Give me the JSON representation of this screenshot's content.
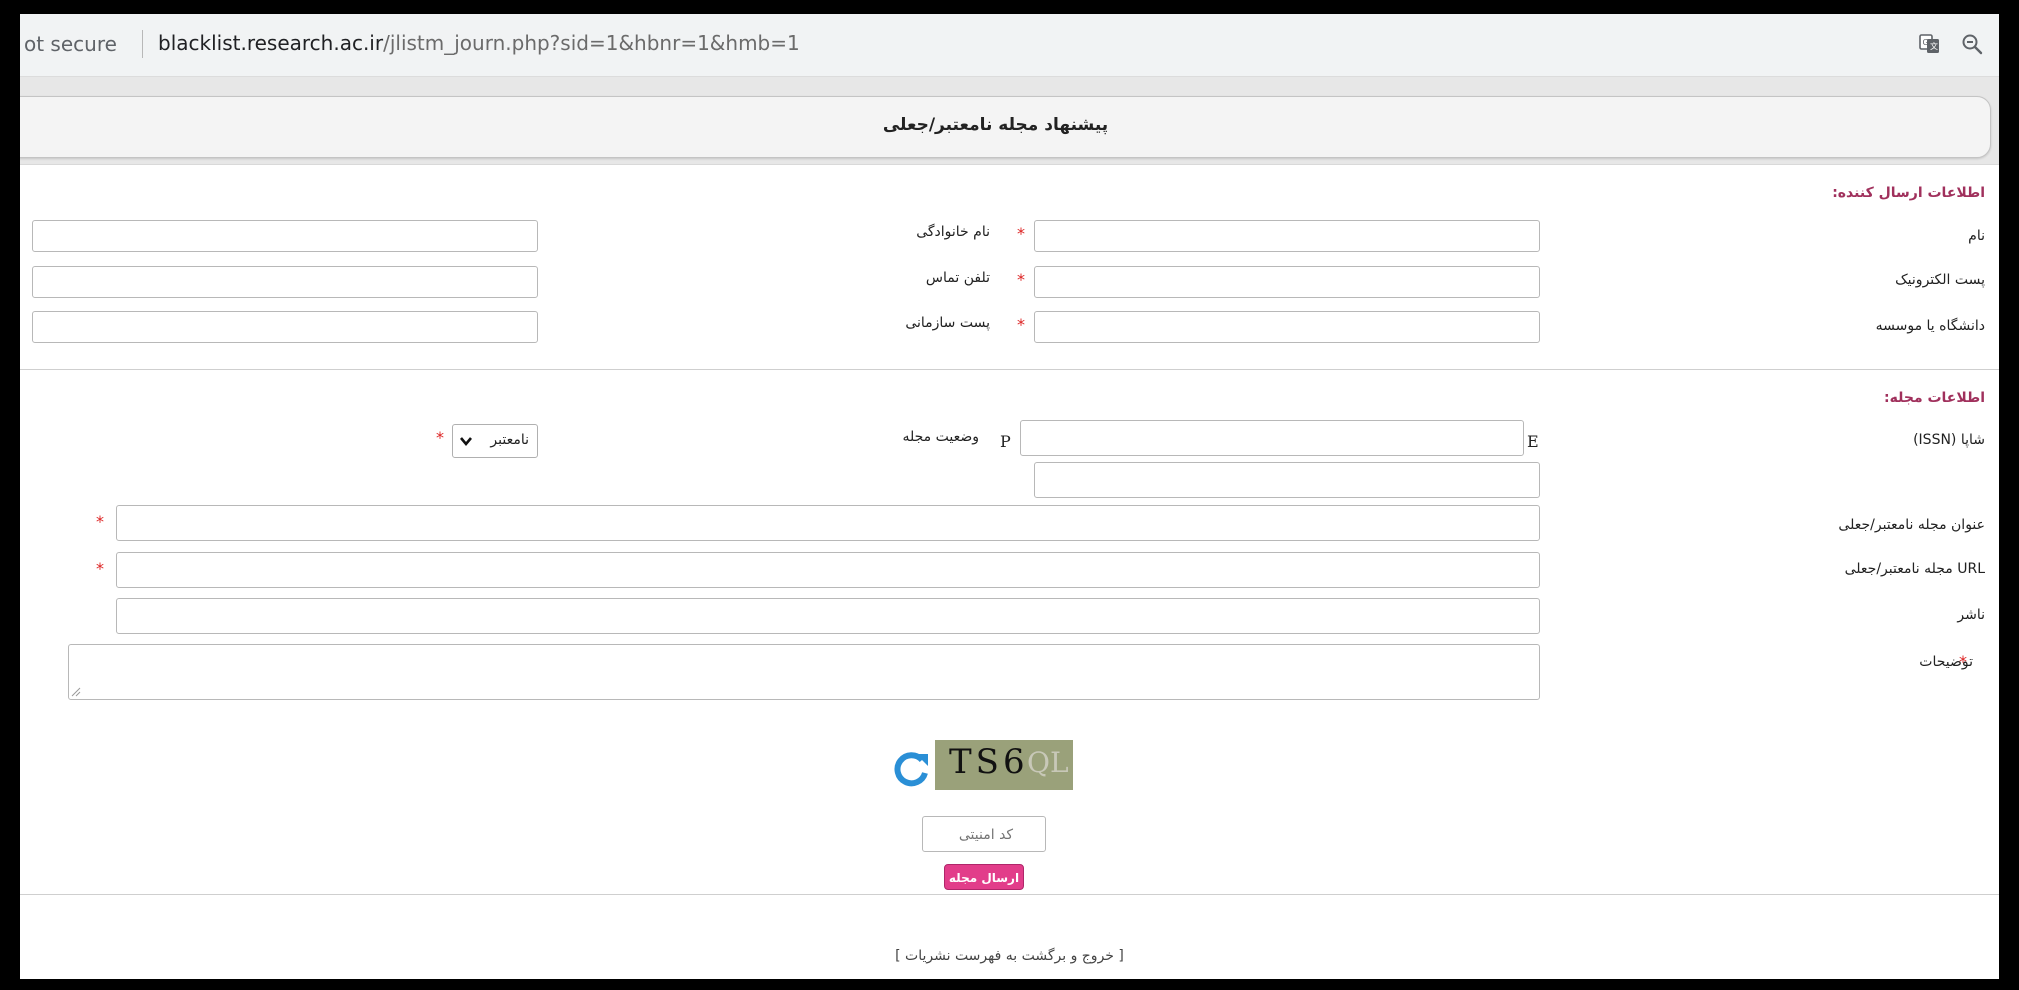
{
  "browser": {
    "security_text": "ot secure",
    "url_domain": "blacklist.research.ac.ir",
    "url_path": "/jlistm_journ.php?sid=1&hbnr=1&hmb=1",
    "icons": [
      "translate-icon",
      "zoom-icon"
    ]
  },
  "page": {
    "title": "پیشنهاد مجله نامعتبر/جعلی"
  },
  "sender": {
    "section_label": "اطلاعات ارسال کننده:",
    "first_name_label": "نام",
    "last_name_label": "نام خانوادگی",
    "email_label": "پست الکترونیک",
    "phone_label": "تلفن تماس",
    "university_label": "دانشگاه یا موسسه",
    "org_email_label": "پست سازمانی",
    "required_mark": "*"
  },
  "journal": {
    "section_label": "اطلاعات مجله:",
    "issn_label": "شاپا (ISSN)",
    "issn_p": "P",
    "issn_e": "E",
    "status_label": "وضعیت مجله",
    "status_selected": "نامعتبر",
    "title_label": "عنوان مجله نامعتبر/جعلی",
    "url_label": "URL مجله نامعتبر/جعلی",
    "publisher_label": "ناشر",
    "description_label": "توضیحات",
    "required_mark": "*"
  },
  "captcha": {
    "image_text": "TS6",
    "image_text2": "QL",
    "input_placeholder": "کد امنیتی",
    "submit_label": "ارسال مجله"
  },
  "footer": {
    "back_link": "[ خروج و برگشت به فهرست نشریات ]"
  }
}
